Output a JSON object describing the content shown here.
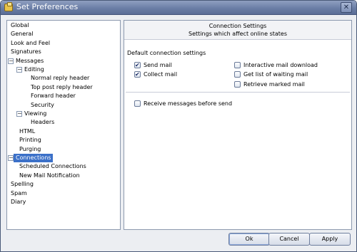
{
  "window": {
    "title": "Set Preferences",
    "close_label": "✕"
  },
  "tree": {
    "items": [
      {
        "label": "Global",
        "indent": 0,
        "expander": ""
      },
      {
        "label": "General",
        "indent": 0,
        "expander": ""
      },
      {
        "label": "Look and Feel",
        "indent": 0,
        "expander": ""
      },
      {
        "label": "Signatures",
        "indent": 0,
        "expander": ""
      },
      {
        "label": "Messages",
        "indent": 0,
        "expander": "−"
      },
      {
        "label": "Editing",
        "indent": 1,
        "expander": "−"
      },
      {
        "label": "Normal reply header",
        "indent": 2,
        "expander": ""
      },
      {
        "label": "Top post reply header",
        "indent": 2,
        "expander": ""
      },
      {
        "label": "Forward header",
        "indent": 2,
        "expander": ""
      },
      {
        "label": "Security",
        "indent": 2,
        "expander": ""
      },
      {
        "label": "Viewing",
        "indent": 1,
        "expander": "−"
      },
      {
        "label": "Headers",
        "indent": 2,
        "expander": ""
      },
      {
        "label": "HTML",
        "indent": 1,
        "expander": ""
      },
      {
        "label": "Printing",
        "indent": 1,
        "expander": ""
      },
      {
        "label": "Purging",
        "indent": 1,
        "expander": ""
      },
      {
        "label": "Connections",
        "indent": 0,
        "expander": "−",
        "selected": true
      },
      {
        "label": "Scheduled Connections",
        "indent": 1,
        "expander": ""
      },
      {
        "label": "New Mail Notification",
        "indent": 1,
        "expander": ""
      },
      {
        "label": "Spelling",
        "indent": 0,
        "expander": ""
      },
      {
        "label": "Spam",
        "indent": 0,
        "expander": ""
      },
      {
        "label": "Diary",
        "indent": 0,
        "expander": ""
      }
    ]
  },
  "panel": {
    "title": "Connection Settings",
    "subtitle": "Settings which affect online states",
    "section_label": "Default connection settings",
    "options_left": [
      {
        "label": "Send mail",
        "checked": true
      },
      {
        "label": "Collect mail",
        "checked": true
      }
    ],
    "options_right": [
      {
        "label": "Interactive mail download",
        "checked": false
      },
      {
        "label": "Get list of waiting mail",
        "checked": false
      },
      {
        "label": "Retrieve marked mail",
        "checked": false
      }
    ],
    "receive_before_send": {
      "label": "Receive messages before send",
      "checked": false
    }
  },
  "buttons": {
    "ok": "Ok",
    "cancel": "Cancel",
    "apply": "Apply"
  },
  "colors": {
    "selection": "#3b70c8",
    "titlebar": "#6b7ea6"
  }
}
